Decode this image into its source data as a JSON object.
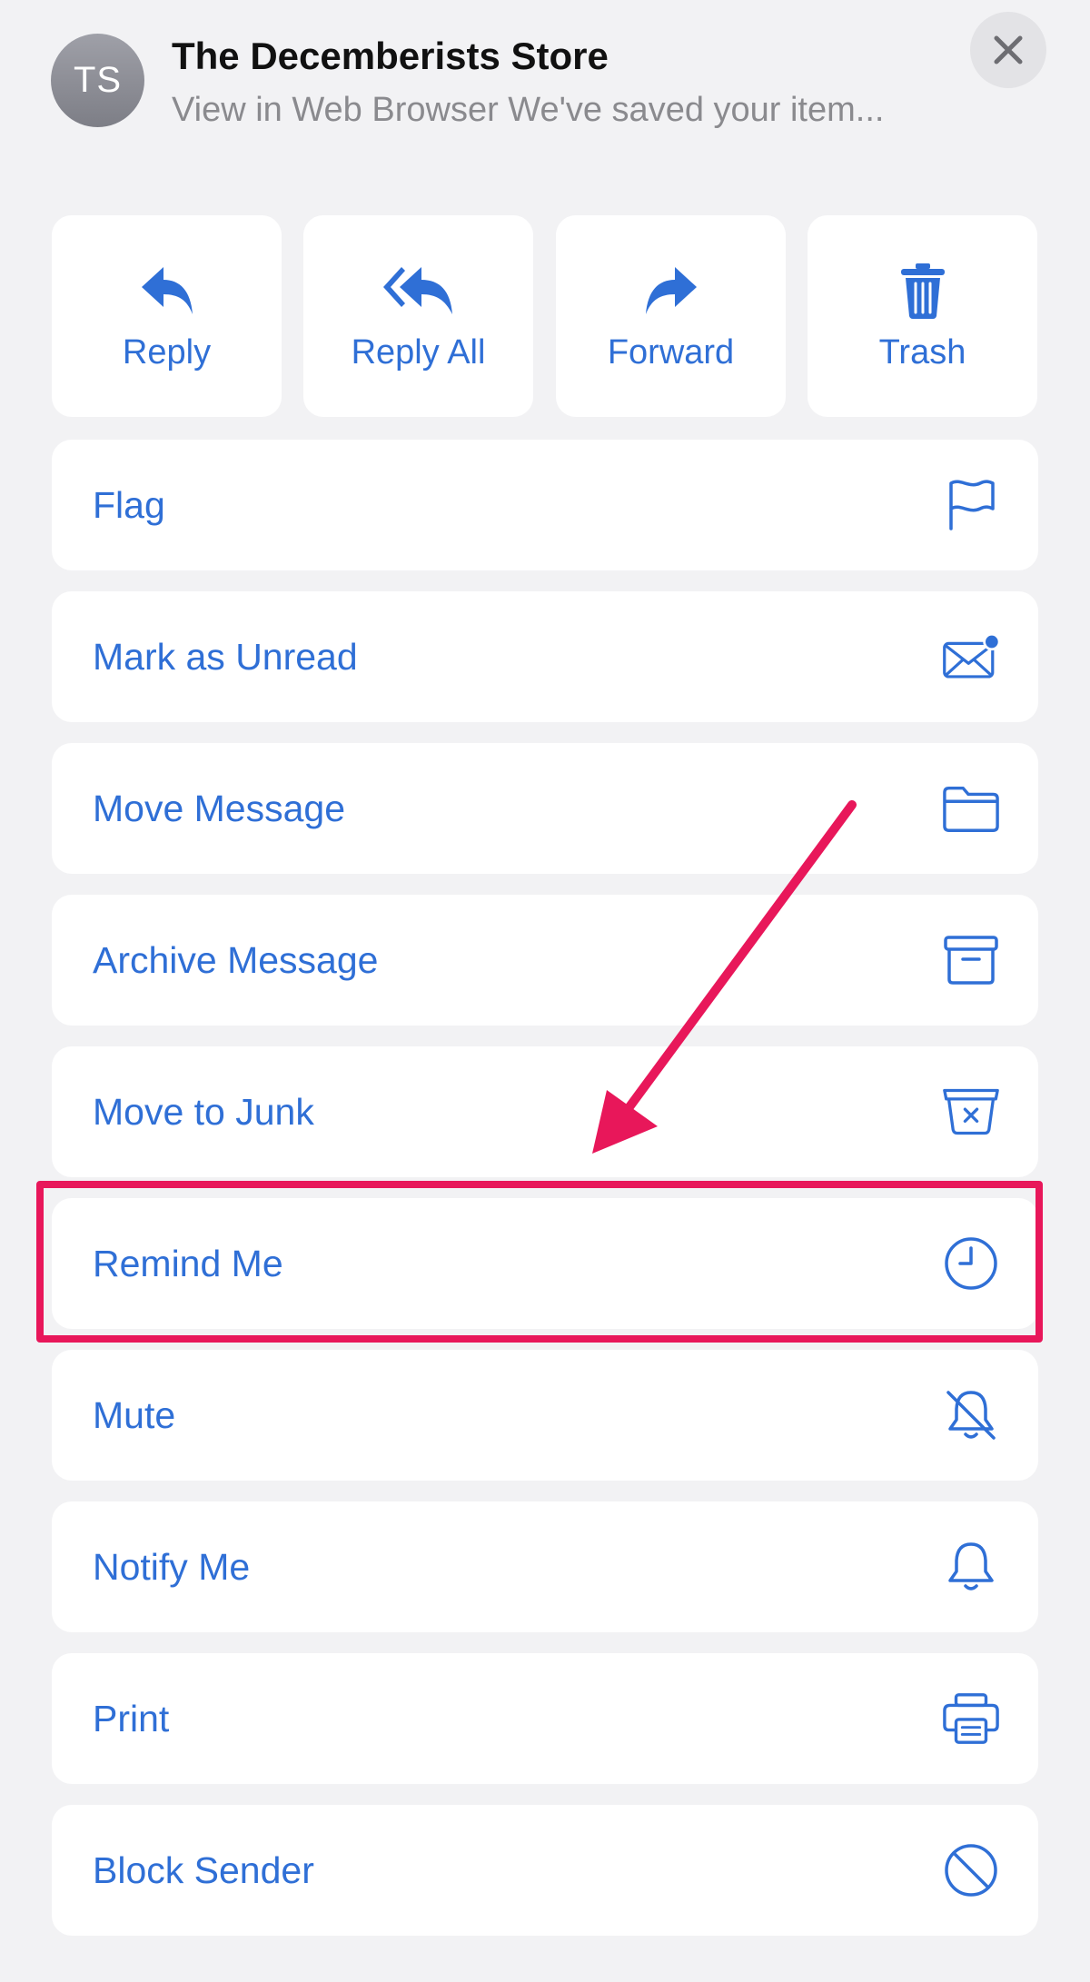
{
  "header": {
    "avatar_initials": "TS",
    "sender": "The Decemberists Store",
    "preview": "View in Web Browser We've saved your item..."
  },
  "actions": [
    {
      "label": "Reply",
      "icon": "reply-icon"
    },
    {
      "label": "Reply All",
      "icon": "reply-all-icon"
    },
    {
      "label": "Forward",
      "icon": "forward-icon"
    },
    {
      "label": "Trash",
      "icon": "trash-icon"
    }
  ],
  "menu": [
    {
      "label": "Flag",
      "icon": "flag-icon"
    },
    {
      "label": "Mark as Unread",
      "icon": "envelope-unread-icon"
    },
    {
      "label": "Move Message",
      "icon": "folder-icon"
    },
    {
      "label": "Archive Message",
      "icon": "archive-box-icon"
    },
    {
      "label": "Move to Junk",
      "icon": "junk-box-icon"
    },
    {
      "label": "Remind Me",
      "icon": "clock-icon"
    },
    {
      "label": "Mute",
      "icon": "bell-slash-icon"
    },
    {
      "label": "Notify Me",
      "icon": "bell-icon"
    },
    {
      "label": "Print",
      "icon": "printer-icon"
    },
    {
      "label": "Block Sender",
      "icon": "block-icon"
    }
  ],
  "colors": {
    "accent": "#2f6fd6",
    "highlight": "#e8175a",
    "background": "#f2f2f4"
  }
}
